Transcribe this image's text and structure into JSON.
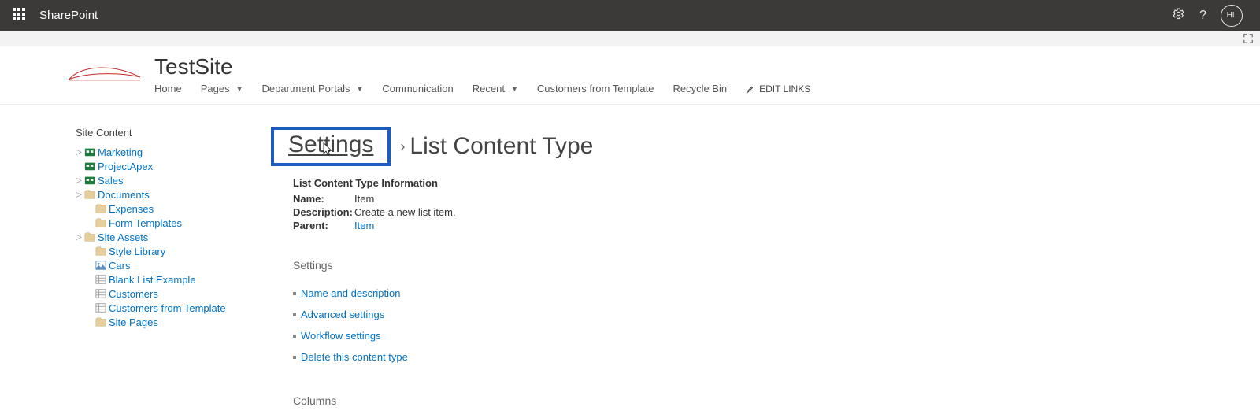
{
  "header": {
    "app": "SharePoint",
    "avatar": "HL"
  },
  "site": {
    "title": "TestSite",
    "nav": {
      "home": "Home",
      "pages": "Pages",
      "dept": "Department Portals",
      "comm": "Communication",
      "recent": "Recent",
      "custtpl": "Customers from Template",
      "recycle": "Recycle Bin",
      "editlinks": "EDIT LINKS"
    }
  },
  "left": {
    "title": "Site Content",
    "items": [
      {
        "label": "Marketing",
        "icon": "subsite",
        "expandable": true
      },
      {
        "label": "ProjectApex",
        "icon": "subsite",
        "expandable": false
      },
      {
        "label": "Sales",
        "icon": "subsite",
        "expandable": true
      },
      {
        "label": "Documents",
        "icon": "lib",
        "expandable": true
      },
      {
        "label": "Expenses",
        "icon": "lib",
        "expandable": false,
        "indent": true
      },
      {
        "label": "Form Templates",
        "icon": "lib",
        "expandable": false,
        "indent": true
      },
      {
        "label": "Site Assets",
        "icon": "lib",
        "expandable": true
      },
      {
        "label": "Style Library",
        "icon": "lib",
        "expandable": false,
        "indent": true
      },
      {
        "label": "Cars",
        "icon": "piclib",
        "expandable": false,
        "indent": true
      },
      {
        "label": "Blank List Example",
        "icon": "list",
        "expandable": false,
        "indent": true
      },
      {
        "label": "Customers",
        "icon": "list",
        "expandable": false,
        "indent": true
      },
      {
        "label": "Customers from Template",
        "icon": "list",
        "expandable": false,
        "indent": true
      },
      {
        "label": "Site Pages",
        "icon": "lib",
        "expandable": false,
        "indent": true
      }
    ]
  },
  "crumb": {
    "settings": "Settings",
    "page": "List Content Type"
  },
  "info": {
    "heading": "List Content Type Information",
    "name_lbl": "Name:",
    "name_val": "Item",
    "desc_lbl": "Description:",
    "desc_val": "Create a new list item.",
    "parent_lbl": "Parent:",
    "parent_val": "Item"
  },
  "settings_section": {
    "title": "Settings",
    "links": {
      "namedesc": "Name and description",
      "advanced": "Advanced settings",
      "workflow": "Workflow settings",
      "delete": "Delete this content type"
    }
  },
  "columns_section": {
    "title": "Columns"
  }
}
